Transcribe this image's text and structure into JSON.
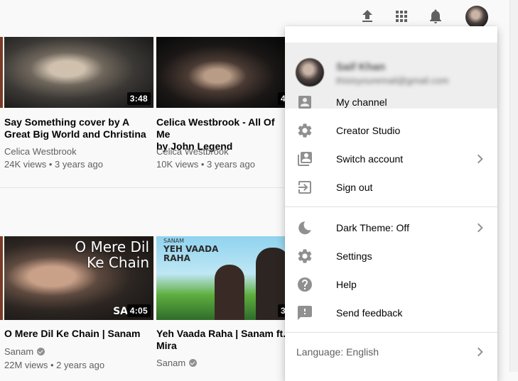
{
  "topbar": {
    "upload_icon": "upload-icon",
    "apps_icon": "apps-grid-icon",
    "notifications_icon": "bell-icon",
    "avatar": "account-avatar"
  },
  "videos": [
    {
      "title_line1": "Say Something cover by A",
      "title_line2": "Great Big World and Christina",
      "channel": "Celica Westbrook",
      "meta": "24K views • 3 years ago",
      "duration": "3:48",
      "verified": false
    },
    {
      "title_line1": "Celica Westbrook - All Of Me",
      "title_line2": "by John Legend",
      "channel": "Celica Westbrook",
      "meta": "10K views • 3 years ago",
      "duration": "4",
      "verified": false
    },
    {
      "title_line1": "O Mere Dil Ke Chain | Sanam",
      "title_line2": "",
      "channel": "Sanam",
      "meta": "22M views • 2 years ago",
      "duration": "4:05",
      "thumb_text_line1": "O Mere Dil",
      "thumb_text_line2": "Ke Chain",
      "thumb_logo": "SA",
      "verified": true
    },
    {
      "title_line1": "Yeh Vaada Raha | Sanam ft.",
      "title_line2": "Mira",
      "channel": "Sanam",
      "meta": "",
      "duration": "3",
      "thumb_text_small": "SANAM",
      "thumb_text_line1": "YEH VAADA",
      "thumb_text_line2": "RAHA",
      "verified": true
    }
  ],
  "account_menu": {
    "name": "Saif Khan",
    "email": "thisisyouremail@gmail.com",
    "items": [
      {
        "label": "My channel",
        "icon": "person-box-icon",
        "chevron": false
      },
      {
        "label": "Creator Studio",
        "icon": "gear-icon",
        "chevron": false
      },
      {
        "label": "Switch account",
        "icon": "switch-account-icon",
        "chevron": true
      },
      {
        "label": "Sign out",
        "icon": "sign-out-icon",
        "chevron": false
      },
      {
        "label": "Dark Theme: Off",
        "icon": "moon-icon",
        "chevron": true
      },
      {
        "label": "Settings",
        "icon": "gear-icon",
        "chevron": false
      },
      {
        "label": "Help",
        "icon": "help-icon",
        "chevron": false
      },
      {
        "label": "Send feedback",
        "icon": "feedback-icon",
        "chevron": false
      }
    ],
    "language": "Language: English"
  }
}
